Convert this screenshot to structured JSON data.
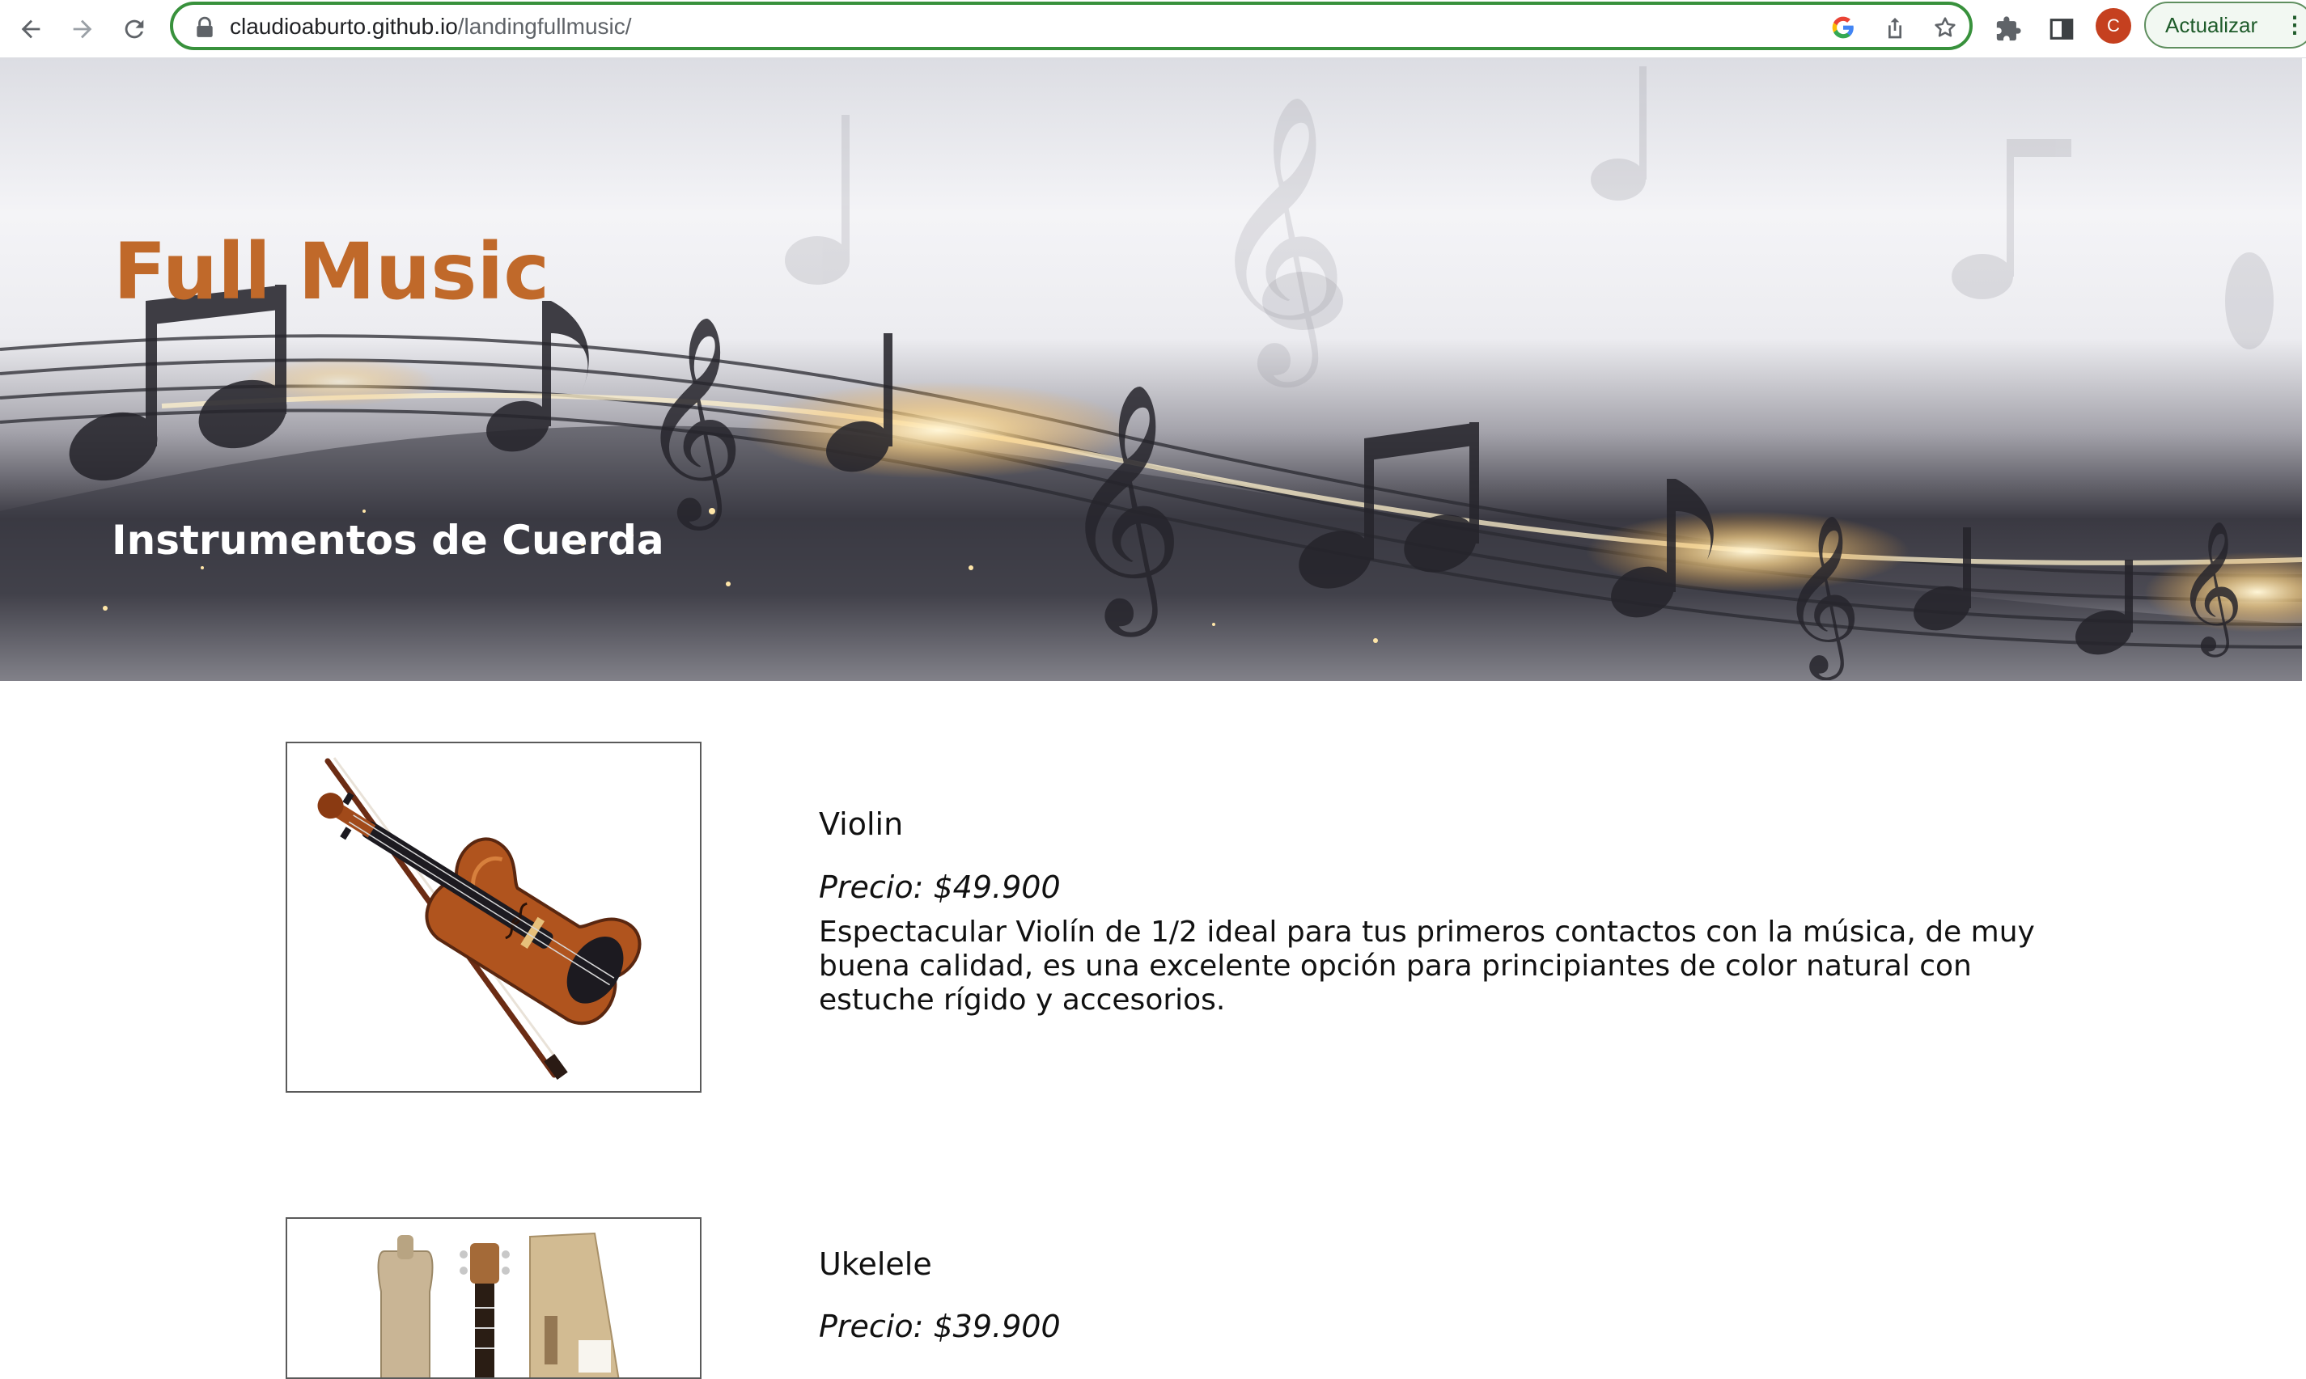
{
  "browser": {
    "url_host": "claudioaburto.github.io",
    "url_path": "/landingfullmusic/",
    "profile_initial": "C",
    "update_label": "Actualizar",
    "menu_glyph": "⋮",
    "icons": [
      "back-arrow-icon",
      "forward-arrow-icon",
      "reload-icon",
      "lock-icon",
      "google-icon",
      "share-icon",
      "bookmark-star-icon",
      "extensions-puzzle-icon",
      "side-panel-icon",
      "kebab-menu-icon"
    ]
  },
  "hero": {
    "site_title": "Full Music",
    "section_title": "Instrumentos de Cuerda"
  },
  "colors": {
    "title_accent": "#c0692a",
    "omnibox_border": "#38913c",
    "avatar": "#c5401f"
  },
  "products": [
    {
      "name": "Violin",
      "price": "Precio: $49.900",
      "description": "Espectacular Violín de 1/2 ideal para tus primeros contactos con la música, de muy buena calidad, es una excelente opción para principiantes de color natural con estuche rígido y accesorios."
    },
    {
      "name": "Ukelele",
      "price": "Precio: $39.900",
      "description": ""
    }
  ]
}
